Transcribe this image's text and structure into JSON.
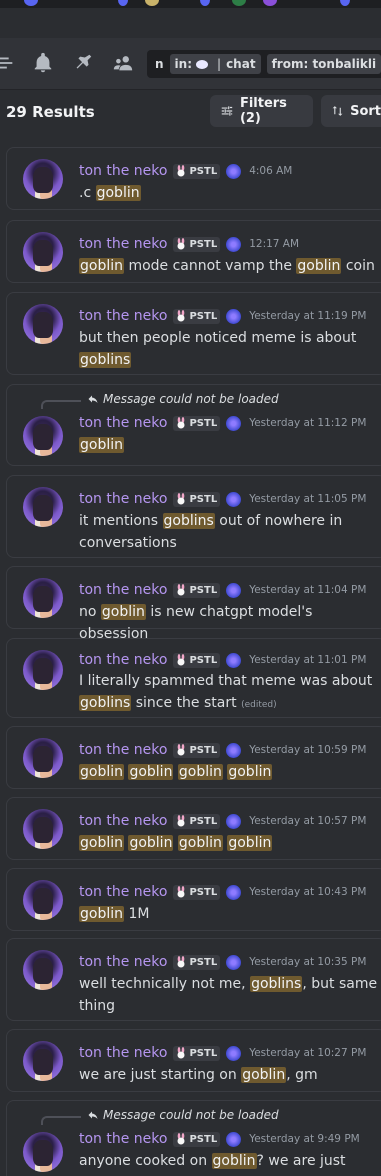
{
  "colors": {
    "background": "#2b2d31",
    "author": "#b596f0",
    "highlight": "#6f5a2f",
    "muted": "#949ba4"
  },
  "header": {
    "icons": [
      "threads-icon",
      "bell-icon",
      "pin-icon",
      "members-icon"
    ],
    "query": {
      "prefix": "n",
      "in_label": "in:",
      "channel": "chat",
      "from_label": "from:",
      "from_value": "tonbalikli"
    }
  },
  "results": {
    "count_label": "29 Results",
    "filters_label": "Filters (2)",
    "sort_label": "Sort"
  },
  "messages": [
    {
      "author": "ton the neko",
      "tag": "PSTL",
      "time": "4:06 AM",
      "parts": [
        {
          "t": ".c "
        },
        {
          "t": "goblin",
          "h": true
        }
      ]
    },
    {
      "author": "ton the neko",
      "tag": "PSTL",
      "time": "12:17 AM",
      "parts": [
        {
          "t": "goblin",
          "h": true
        },
        {
          "t": " mode cannot vamp the "
        },
        {
          "t": "goblin",
          "h": true
        },
        {
          "t": " coin"
        }
      ]
    },
    {
      "author": "ton the neko",
      "tag": "PSTL",
      "time": "Yesterday at 11:19 PM",
      "parts": [
        {
          "t": "but then people noticed meme is about "
        },
        {
          "t": "goblins",
          "h": true
        }
      ]
    },
    {
      "reply": "Message could not be loaded",
      "author": "ton the neko",
      "tag": "PSTL",
      "time": "Yesterday at 11:12 PM",
      "parts": [
        {
          "t": "goblin",
          "h": true
        }
      ]
    },
    {
      "author": "ton the neko",
      "tag": "PSTL",
      "time": "Yesterday at 11:05 PM",
      "parts": [
        {
          "t": "it mentions "
        },
        {
          "t": "goblins",
          "h": true
        },
        {
          "t": " out of nowhere in conversations"
        }
      ]
    },
    {
      "author": "ton the neko",
      "tag": "PSTL",
      "time": "Yesterday at 11:04 PM",
      "parts": [
        {
          "t": "no "
        },
        {
          "t": "goblin",
          "h": true
        },
        {
          "t": " is new chatgpt model's obsession"
        }
      ]
    },
    {
      "author": "ton the neko",
      "tag": "PSTL",
      "time": "Yesterday at 11:01 PM",
      "parts": [
        {
          "t": "I literally spammed that meme was about "
        },
        {
          "t": "goblins",
          "h": true
        },
        {
          "t": " since the start "
        },
        {
          "t": "(edited)",
          "e": true
        }
      ]
    },
    {
      "author": "ton the neko",
      "tag": "PSTL",
      "time": "Yesterday at 10:59 PM",
      "parts": [
        {
          "t": "goblin",
          "h": true
        },
        {
          "t": " "
        },
        {
          "t": "goblin",
          "h": true
        },
        {
          "t": " "
        },
        {
          "t": "goblin",
          "h": true
        },
        {
          "t": " "
        },
        {
          "t": "goblin",
          "h": true
        }
      ]
    },
    {
      "author": "ton the neko",
      "tag": "PSTL",
      "time": "Yesterday at 10:57 PM",
      "parts": [
        {
          "t": "goblin",
          "h": true
        },
        {
          "t": " "
        },
        {
          "t": "goblin",
          "h": true
        },
        {
          "t": " "
        },
        {
          "t": "goblin",
          "h": true
        },
        {
          "t": " "
        },
        {
          "t": "goblin",
          "h": true
        }
      ]
    },
    {
      "author": "ton the neko",
      "tag": "PSTL",
      "time": "Yesterday at 10:43 PM",
      "parts": [
        {
          "t": "goblin",
          "h": true
        },
        {
          "t": " 1M"
        }
      ]
    },
    {
      "author": "ton the neko",
      "tag": "PSTL",
      "time": "Yesterday at 10:35 PM",
      "parts": [
        {
          "t": "well technically not me, "
        },
        {
          "t": "goblins",
          "h": true
        },
        {
          "t": ", but same thing"
        }
      ]
    },
    {
      "author": "ton the neko",
      "tag": "PSTL",
      "time": "Yesterday at 10:27 PM",
      "parts": [
        {
          "t": "we are just starting on "
        },
        {
          "t": "goblin",
          "h": true
        },
        {
          "t": ", gm"
        }
      ]
    },
    {
      "reply": "Message could not be loaded",
      "author": "ton the neko",
      "tag": "PSTL",
      "time": "Yesterday at 9:49 PM",
      "parts": [
        {
          "t": "anyone cooked on "
        },
        {
          "t": "goblin",
          "h": true
        },
        {
          "t": "? we are just"
        }
      ]
    }
  ]
}
